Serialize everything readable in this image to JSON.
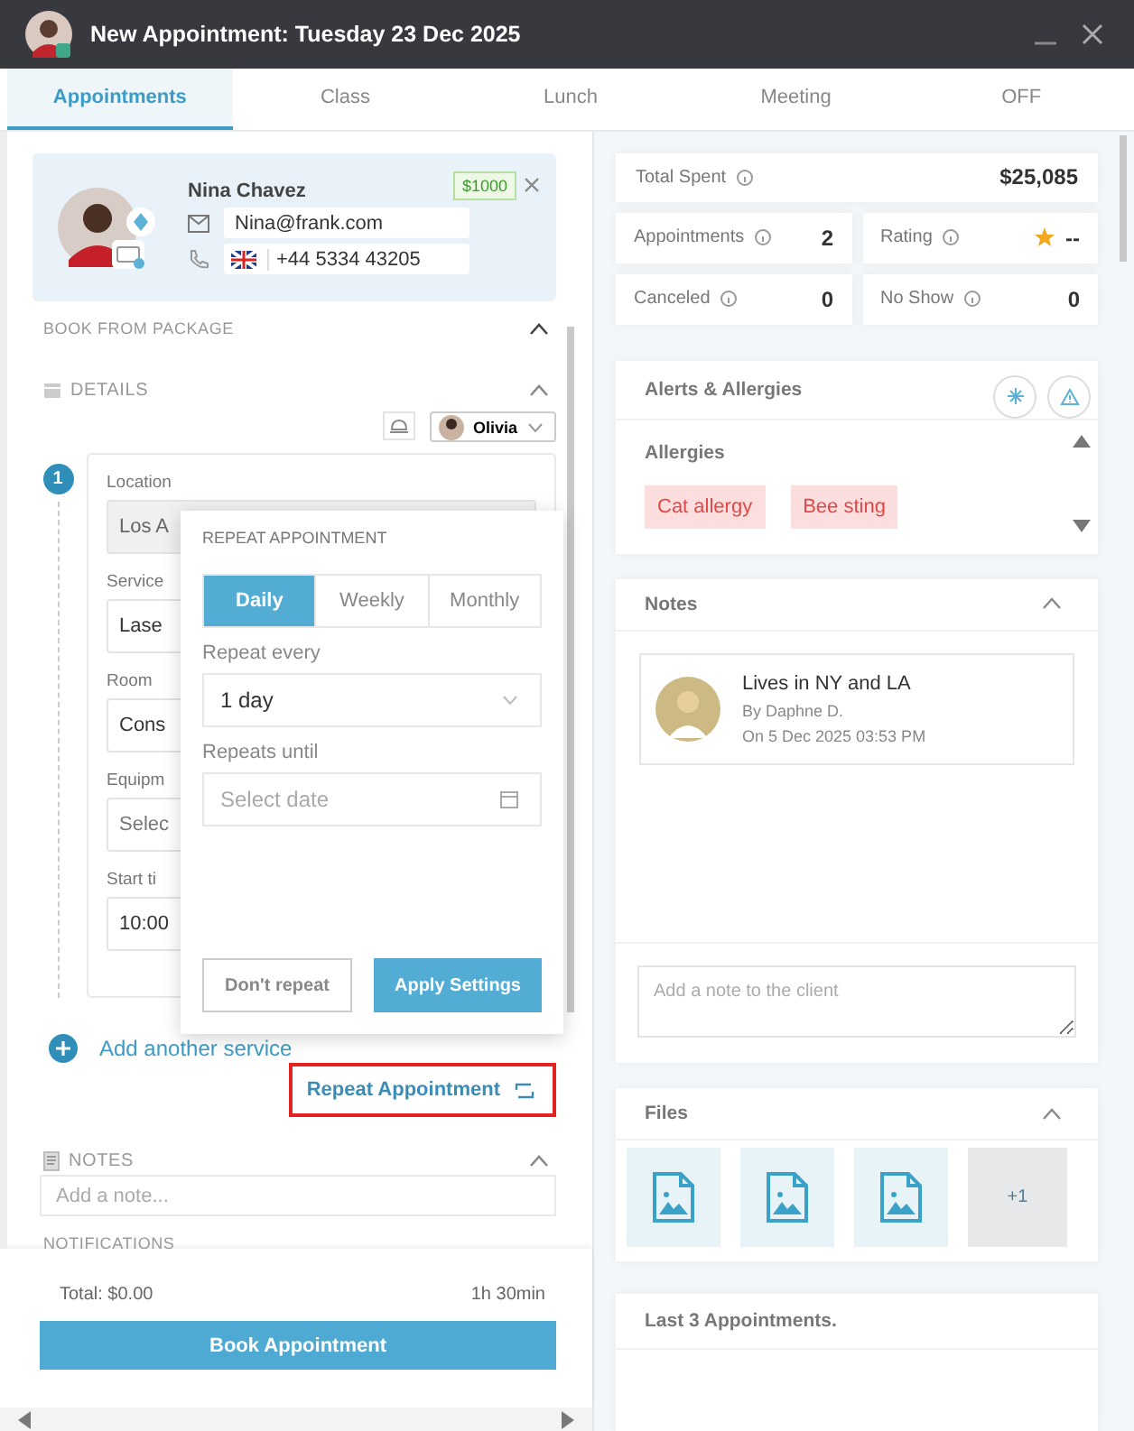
{
  "window": {
    "title": "New Appointment: Tuesday 23 Dec 2025"
  },
  "tabs": [
    {
      "label": "Appointments",
      "selected": true
    },
    {
      "label": "Class",
      "selected": false
    },
    {
      "label": "Lunch",
      "selected": false
    },
    {
      "label": "Meeting",
      "selected": false
    },
    {
      "label": "OFF",
      "selected": false
    }
  ],
  "client": {
    "name": "Nina Chavez",
    "email": "Nina@frank.com",
    "phone": "+44 5334 43205",
    "balance": "$1000"
  },
  "sections": {
    "package": "BOOK FROM PACKAGE",
    "details": "DETAILS",
    "notes": "NOTES",
    "notifications": "NOTIFICATIONS"
  },
  "staff": {
    "name": "Olivia"
  },
  "service": {
    "step": "1",
    "fields": [
      {
        "label": "Location",
        "value": "Los A",
        "kind": "locked"
      },
      {
        "label": "Service",
        "value": "Lase",
        "kind": "value"
      },
      {
        "label": "Room",
        "value": "Cons",
        "kind": "value"
      },
      {
        "label": "Equipm",
        "placeholder": "Selec",
        "kind": "hint"
      },
      {
        "label": "Start ti",
        "value": "10:00",
        "kind": "value"
      }
    ]
  },
  "add_service": "Add another service",
  "repeat_link": "Repeat Appointment",
  "notes_placeholder": "Add a note...",
  "footer": {
    "total": "Total: $0.00",
    "duration": "1h 30min",
    "book": "Book Appointment"
  },
  "repeat_popup": {
    "title": "REPEAT APPOINTMENT",
    "modes": [
      {
        "label": "Daily",
        "selected": true
      },
      {
        "label": "Weekly",
        "selected": false
      },
      {
        "label": "Monthly",
        "selected": false
      }
    ],
    "every_label": "Repeat every",
    "every_value": "1 day",
    "until_label": "Repeats until",
    "until_placeholder": "Select date",
    "cancel": "Don't repeat",
    "apply": "Apply Settings"
  },
  "stats": {
    "total": {
      "label": "Total Spent",
      "value": "$25,085"
    },
    "items": [
      {
        "label": "Appointments",
        "value": "2",
        "kind": "count"
      },
      {
        "label": "Rating",
        "value": "--",
        "kind": "rating"
      },
      {
        "label": "Canceled",
        "value": "0",
        "kind": "count"
      },
      {
        "label": "No Show",
        "value": "0",
        "kind": "count"
      }
    ]
  },
  "alerts": {
    "title": "Alerts & Allergies",
    "subtitle": "Allergies",
    "tags": [
      "Cat allergy",
      "Bee sting"
    ]
  },
  "client_notes": {
    "title": "Notes",
    "items": [
      {
        "text": "Lives in NY and LA",
        "author": "By Daphne D.",
        "date": "On 5 Dec 2025 03:53 PM"
      }
    ],
    "placeholder": "Add a note to the client"
  },
  "files": {
    "title": "Files",
    "items": [
      {
        "kind": "image"
      },
      {
        "kind": "image"
      },
      {
        "kind": "image"
      }
    ],
    "more": "+1"
  },
  "last_appointments": {
    "title": "Last 3 Appointments."
  }
}
